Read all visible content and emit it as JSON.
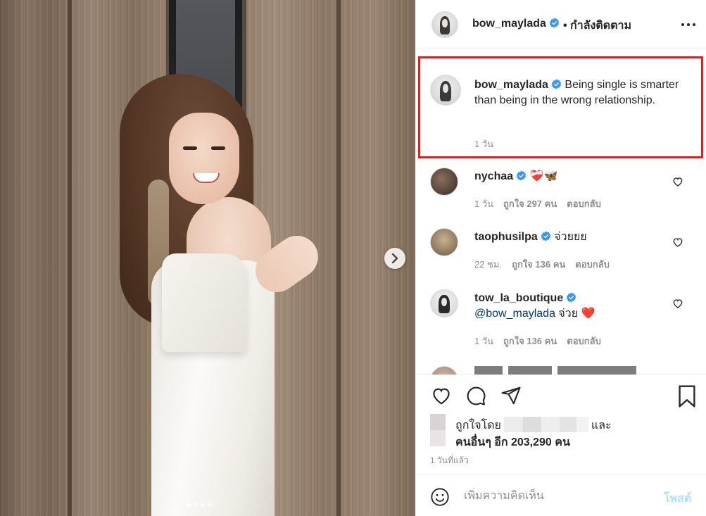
{
  "post": {
    "photo_alt": "",
    "carousel": {
      "total": 4,
      "active": 1
    }
  },
  "header": {
    "username": "bow_maylada",
    "follow_status": "• กำลังติดตาม",
    "more_icon": "more-horizontal-icon"
  },
  "caption": {
    "username": "bow_maylada",
    "text": "Being single is smarter than being in the wrong relationship.",
    "time": "1 วัน"
  },
  "comments": [
    {
      "username": "nychaa",
      "verified": true,
      "text": "❤️‍🩹🦋",
      "time": "1 วัน",
      "likes": "ถูกใจ 297 คน",
      "reply": "ตอบกลับ"
    },
    {
      "username": "taophusilpa",
      "verified": true,
      "text": "จ่วยยย",
      "time": "22 ชม.",
      "likes": "ถูกใจ 136 คน",
      "reply": "ตอบกลับ"
    },
    {
      "username": "tow_la_boutique",
      "verified": true,
      "mention": "@bow_maylada",
      "text": "จ่วย ❤️",
      "time": "1 วัน",
      "likes": "ถูกใจ 136 คน",
      "reply": "ตอบกลับ"
    }
  ],
  "likes": {
    "prefix": "ถูกใจโดย",
    "suffix": "และ",
    "others": "คนอื่นๆ อีก 203,290 คน"
  },
  "post_time": "1 วันที่แล้ว",
  "comment_box": {
    "placeholder": "เพิ่มความคิดเห็น",
    "post_label": "โพสต์"
  },
  "colors": {
    "verified_blue": "#3897f0",
    "highlight_red": "#e0201f",
    "mention_blue": "#00376b",
    "post_disabled": "#b2dffc"
  }
}
